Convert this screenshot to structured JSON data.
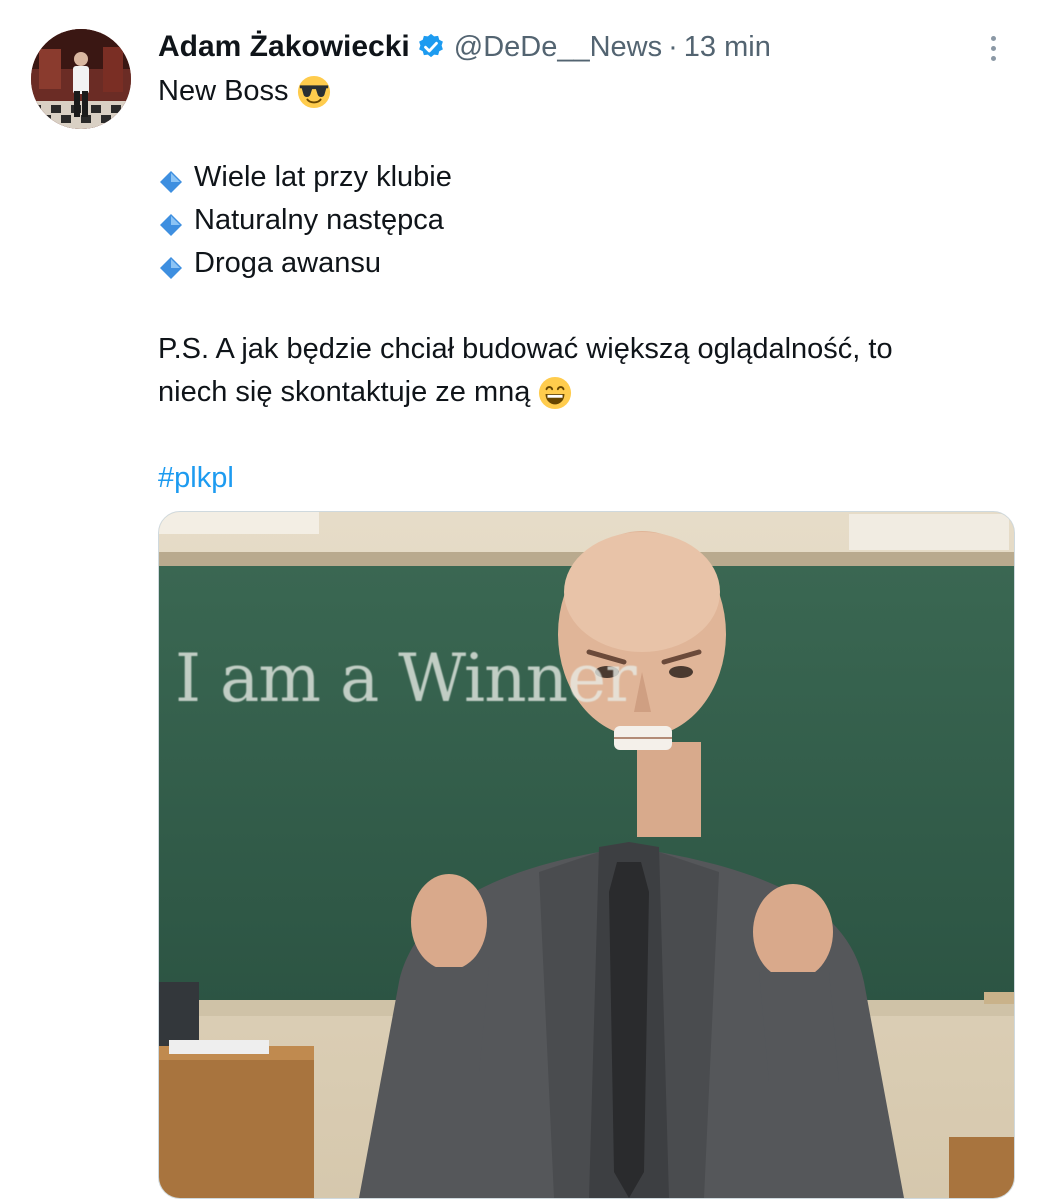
{
  "tweet": {
    "author_name": "Adam Żakowiecki",
    "handle": "@DeDe__News",
    "separator": "·",
    "time": "13 min",
    "verified": true,
    "lines": [
      "New Boss",
      "",
      "Wiele lat przy klubie",
      "Naturalny następca",
      "Droga awansu",
      "",
      "P.S. A jak będzie chciał budować większą oglądalność, to",
      "niech się skontaktuje ze mną",
      ""
    ],
    "hashtag": "#plkpl",
    "emoji_after_title": "smiling-face-with-sunglasses-icon",
    "emoji_after_ps": "beaming-face-icon",
    "bullet_icon": "small-blue-diamond-icon"
  },
  "media": {
    "board_text": "I am a Winner"
  },
  "colors": {
    "link": "#1d9bf0",
    "secondary_text": "#536471",
    "verified": "#1d9bf0",
    "chalkboard": "#2f5a48"
  }
}
